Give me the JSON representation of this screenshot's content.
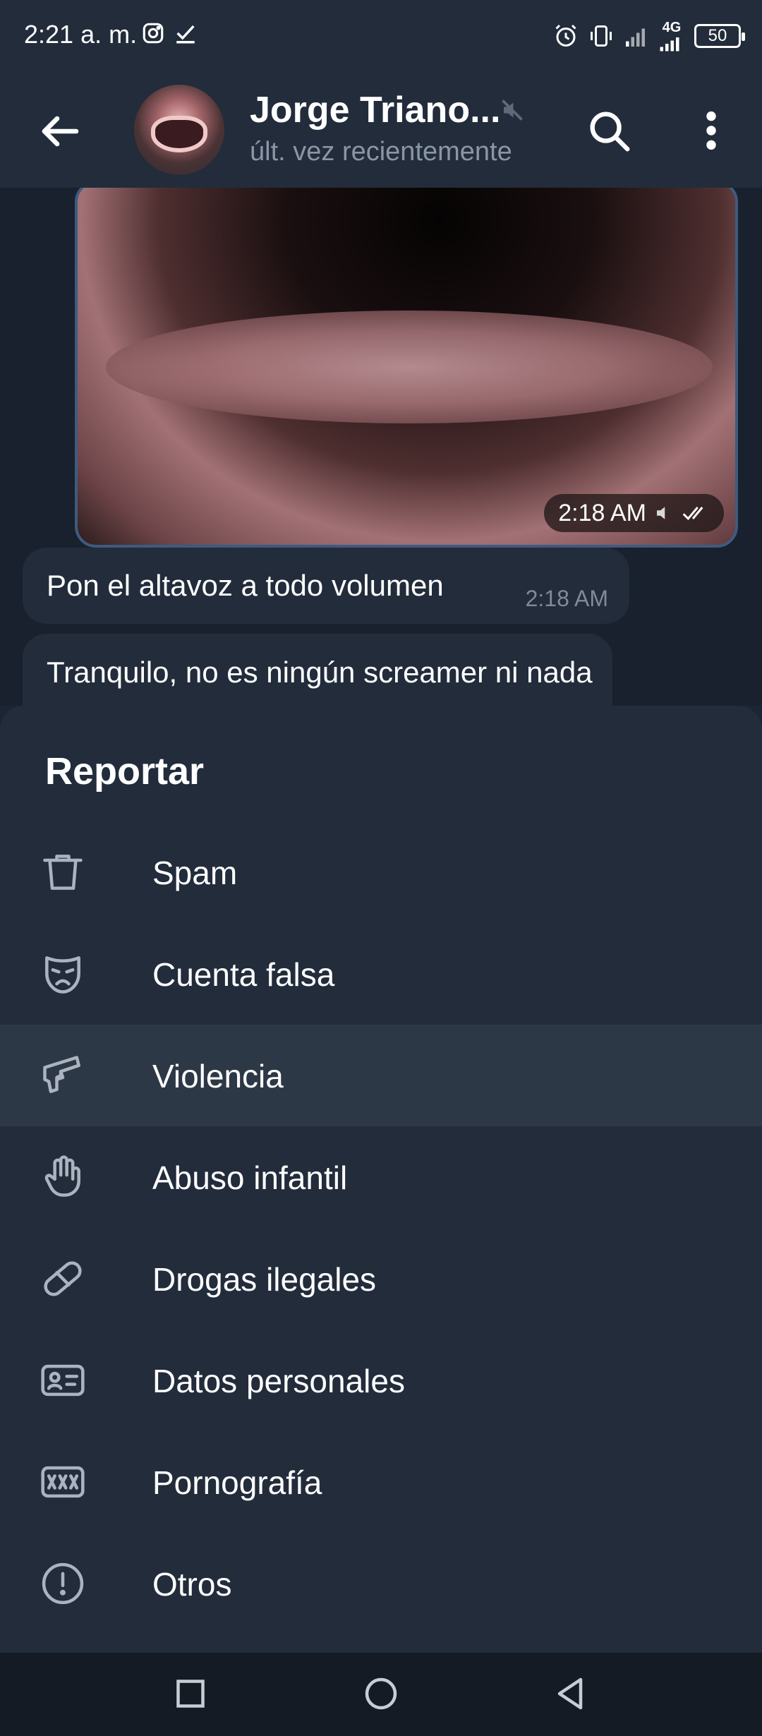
{
  "status_bar": {
    "time": "2:21 a. m.",
    "network": "4G",
    "battery": "50"
  },
  "header": {
    "contact_name": "Jorge Triano...",
    "contact_status": "últ. vez recientemente"
  },
  "chat": {
    "video_time": "2:18 AM",
    "messages": [
      {
        "text": "Pon el altavoz a todo volumen",
        "time": "2:18 AM"
      },
      {
        "text": "Tranquilo, no es ningún screamer ni nada"
      }
    ]
  },
  "report_sheet": {
    "title": "Reportar",
    "items": [
      {
        "label": "Spam",
        "icon": "trash-icon"
      },
      {
        "label": "Cuenta falsa",
        "icon": "mask-icon"
      },
      {
        "label": "Violencia",
        "icon": "gun-icon",
        "selected": true
      },
      {
        "label": "Abuso infantil",
        "icon": "hand-icon"
      },
      {
        "label": "Drogas ilegales",
        "icon": "pill-icon"
      },
      {
        "label": "Datos personales",
        "icon": "id-card-icon"
      },
      {
        "label": "Pornografía",
        "icon": "xxx-icon"
      },
      {
        "label": "Otros",
        "icon": "exclamation-icon"
      }
    ]
  },
  "colors": {
    "background": "#18212d",
    "sheet": "#222c3b",
    "selected_row": "#2d3846",
    "icon_stroke": "#aab3bf",
    "secondary_text": "#8a96a6"
  }
}
